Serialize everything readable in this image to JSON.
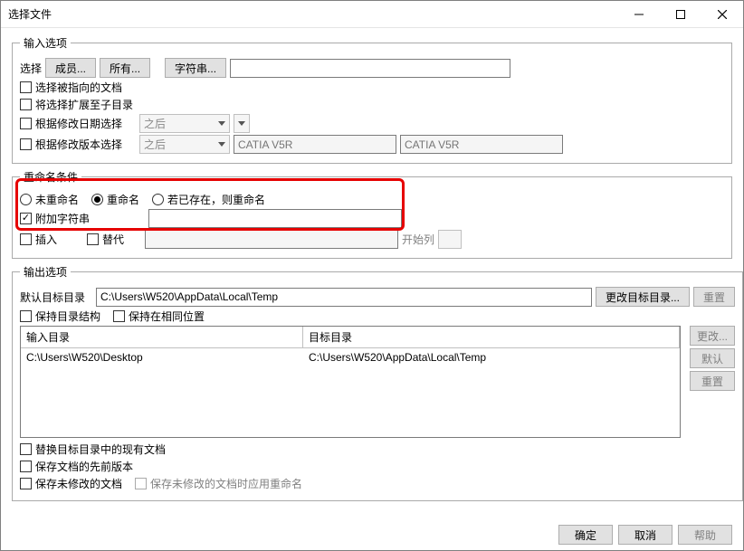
{
  "title": "选择文件",
  "titlebar": {
    "min": "—",
    "max": "☐",
    "close": "✕"
  },
  "input_options": {
    "legend": "输入选项",
    "select_label": "选择",
    "members_btn": "成员...",
    "all_btn": "所有...",
    "string_btn": "字符串...",
    "chk_select_pointed_doc": "选择被指向的文档",
    "chk_extend_to_subdir": "将选择扩展至子目录",
    "chk_select_by_mod_date": "根据修改日期选择",
    "after1": "之后",
    "chk_select_by_version": "根据修改版本选择",
    "after2": "之后",
    "catia_placeholder": "CATIA V5R"
  },
  "rename": {
    "legend": "重命名条件",
    "radio_norename": "未重命名",
    "radio_rename": "重命名",
    "radio_rename_if_exists": "若已存在，则重命名",
    "chk_append_string": "附加字符串",
    "chk_insert": "插入",
    "chk_replace": "替代",
    "start_col": "开始列"
  },
  "output": {
    "legend": "输出选项",
    "default_target_dir_label": "默认目标目录",
    "default_target_dir_value": "C:\\Users\\W520\\AppData\\Local\\Temp",
    "change_target_dir_btn": "更改目标目录...",
    "reset_btn": "重置",
    "chk_keep_dir_struct": "保持目录结构",
    "chk_keep_same_loc": "保持在相同位置",
    "col_input_dir": "输入目录",
    "col_target_dir": "目标目录",
    "row_input_dir": "C:\\Users\\W520\\Desktop",
    "row_target_dir": "C:\\Users\\W520\\AppData\\Local\\Temp",
    "side_change": "更改...",
    "side_default": "默认",
    "side_reset": "重置",
    "chk_replace_existing": "替换目标目录中的现有文档",
    "chk_save_prev_version": "保存文档的先前版本",
    "chk_save_unmodified": "保存未修改的文档",
    "chk_save_unmodified_rename": "保存未修改的文档时应用重命名"
  },
  "footer": {
    "ok": "确定",
    "cancel": "取消",
    "help": "帮助"
  }
}
